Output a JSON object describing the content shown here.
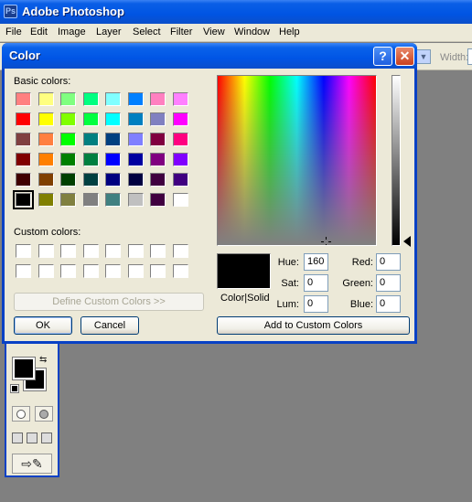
{
  "photoshop": {
    "title": "Adobe Photoshop",
    "menu": [
      "File",
      "Edit",
      "Image",
      "Layer",
      "Select",
      "Filter",
      "View",
      "Window",
      "Help"
    ],
    "options_bar": {
      "width_label": "Width:"
    }
  },
  "dialog": {
    "title": "Color",
    "help_glyph": "?",
    "close_glyph": "✕",
    "basic_colors_label": "Basic colors:",
    "custom_colors_label": "Custom colors:",
    "basic_colors": [
      "#ff8080",
      "#ffff80",
      "#80ff80",
      "#00ff80",
      "#80ffff",
      "#0080ff",
      "#ff80c0",
      "#ff80ff",
      "#ff0000",
      "#ffff00",
      "#80ff00",
      "#00ff40",
      "#00ffff",
      "#0080c0",
      "#8080c0",
      "#ff00ff",
      "#804040",
      "#ff8040",
      "#00ff00",
      "#008080",
      "#004080",
      "#8080ff",
      "#800040",
      "#ff0080",
      "#800000",
      "#ff8000",
      "#008000",
      "#008040",
      "#0000ff",
      "#0000a0",
      "#800080",
      "#8000ff",
      "#400000",
      "#804000",
      "#004000",
      "#004040",
      "#000080",
      "#000040",
      "#400040",
      "#400080",
      "#000000",
      "#808000",
      "#808040",
      "#808080",
      "#408080",
      "#c0c0c0",
      "#400040",
      "#ffffff"
    ],
    "selected_basic_index": 40,
    "custom_colors": [
      "#ffffff",
      "#ffffff",
      "#ffffff",
      "#ffffff",
      "#ffffff",
      "#ffffff",
      "#ffffff",
      "#ffffff",
      "#ffffff",
      "#ffffff",
      "#ffffff",
      "#ffffff",
      "#ffffff",
      "#ffffff",
      "#ffffff",
      "#ffffff"
    ],
    "define_custom_label": "Define Custom Colors >>",
    "ok_label": "OK",
    "cancel_label": "Cancel",
    "add_custom_label": "Add to Custom Colors",
    "color_solid_label": "Color|Solid",
    "preview_color": "#000000",
    "fields": {
      "hue_label": "Hue:",
      "hue": "160",
      "sat_label": "Sat:",
      "sat": "0",
      "lum_label": "Lum:",
      "lum": "0",
      "red_label": "Red:",
      "red": "0",
      "green_label": "Green:",
      "green": "0",
      "blue_label": "Blue:",
      "blue": "0"
    }
  },
  "toolbox": {
    "foreground_color": "#000000",
    "background_color": "#000000"
  }
}
